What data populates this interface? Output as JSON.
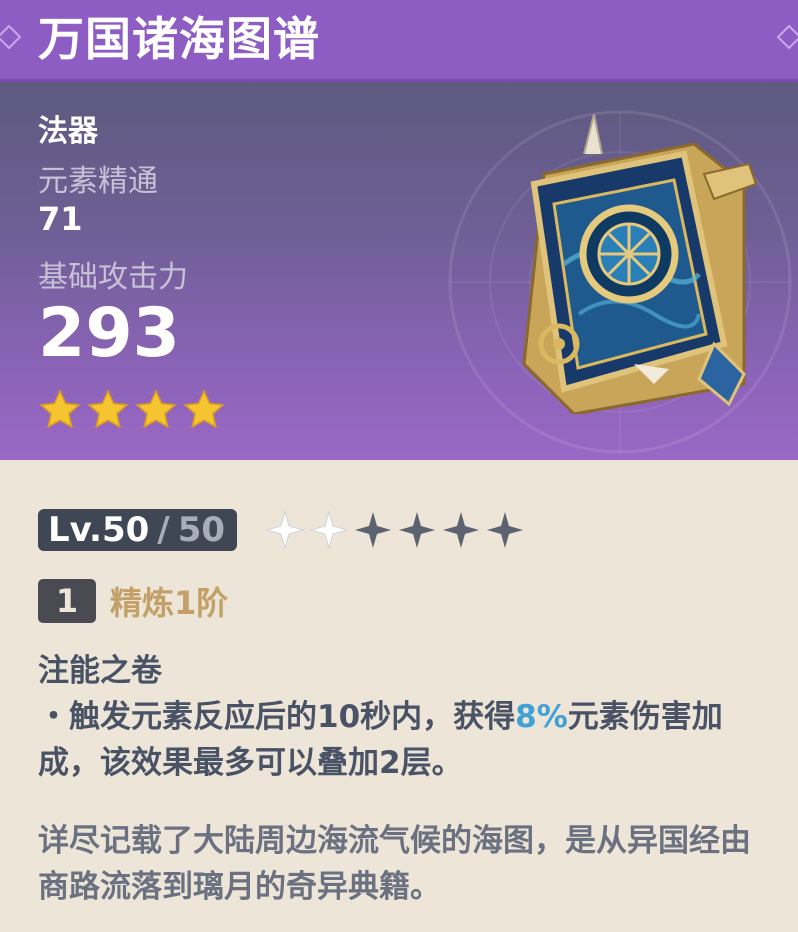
{
  "weapon": {
    "name": "万国诸海图谱",
    "type": "法器",
    "secondary_stat_name": "元素精通",
    "secondary_stat_value": "71",
    "base_atk_name": "基础攻击力",
    "base_atk_value": "293",
    "rarity": 4
  },
  "level": {
    "current": "Lv.50",
    "separator": "/",
    "max": "50",
    "ascension_filled": 2,
    "ascension_total": 6
  },
  "refinement": {
    "rank": "1",
    "label": "精炼1阶"
  },
  "passive": {
    "name": "注能之卷",
    "desc_part1": "・触发元素反应后的10秒内，获得",
    "highlight": "8%",
    "desc_part2": "元素伤害加成，该效果最多可以叠加2层。"
  },
  "lore": "详尽记载了大陆周边海流气候的海图，是从异国经由商路流落到璃月的奇异典籍。",
  "colors": {
    "title_bar": "#8d5dc4",
    "star_gold": "#f5c431",
    "highlight_blue": "#3fa1d6",
    "refine_gold": "#c4a069"
  }
}
